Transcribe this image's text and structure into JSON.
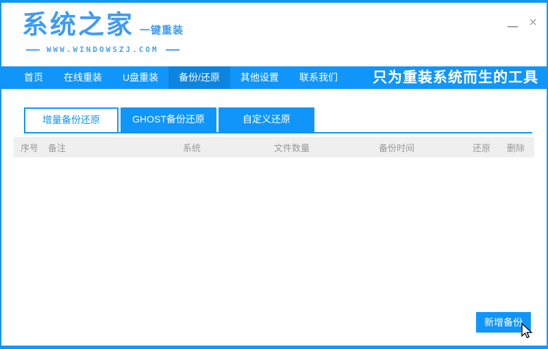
{
  "window": {
    "controls": {
      "minimize": "minimize",
      "close_glyph": "×"
    }
  },
  "header": {
    "logo_text": "系统之家",
    "logo_subtitle": "一键重装",
    "website": "WWW.WINDOWSZJ.COM"
  },
  "navbar": {
    "items": [
      {
        "label": "首页",
        "active": false
      },
      {
        "label": "在线重装",
        "active": false
      },
      {
        "label": "U盘重装",
        "active": false
      },
      {
        "label": "备份/还原",
        "active": true
      },
      {
        "label": "其他设置",
        "active": false
      },
      {
        "label": "联系我们",
        "active": false
      }
    ],
    "slogan": "只为重装系统而生的工具"
  },
  "tabs": [
    {
      "label": "增量备份还原",
      "active": true
    },
    {
      "label": "GHOST备份还原",
      "active": false
    },
    {
      "label": "自定义还原",
      "active": false
    }
  ],
  "table": {
    "columns": [
      "序号",
      "备注",
      "系统",
      "文件数量",
      "备份时间",
      "还原",
      "删除"
    ],
    "rows": []
  },
  "actions": {
    "new_backup_label": "新增备份"
  },
  "colors": {
    "primary": "#1095fa",
    "primary_dark": "#0c85e0",
    "logo_blue": "#3f9bf3",
    "table_header_bg": "#efefef",
    "table_header_text": "#999999"
  }
}
